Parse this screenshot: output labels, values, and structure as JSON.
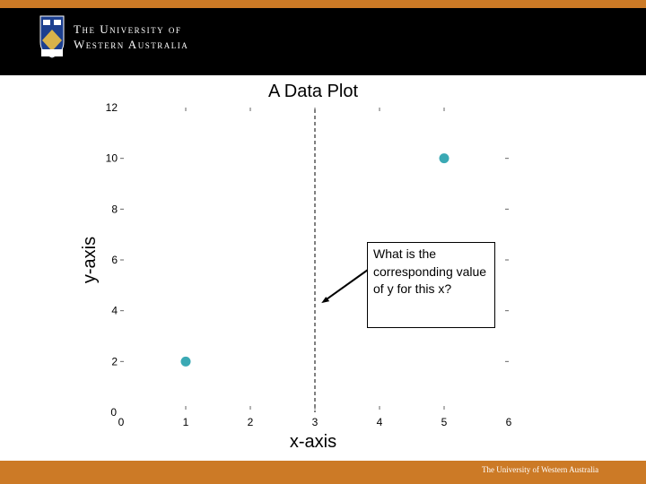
{
  "header": {
    "institution_line1": "The University of",
    "institution_line2": "Western Australia"
  },
  "footer": {
    "text": "The University of Western Australia"
  },
  "colors": {
    "accent": "#cc7a26",
    "header_bg": "#000000",
    "point": "#3aa9b4"
  },
  "chart_data": {
    "type": "scatter",
    "title": "A Data Plot",
    "xlabel": "x-axis",
    "ylabel": "y-axis",
    "xlim": [
      0,
      6
    ],
    "ylim": [
      0,
      12
    ],
    "xticks": [
      "0",
      "1",
      "2",
      "3",
      "4",
      "5",
      "6"
    ],
    "yticks": [
      "0",
      "2",
      "4",
      "6",
      "8",
      "10",
      "12"
    ],
    "grid": false,
    "points": [
      {
        "x": 1,
        "y": 2
      },
      {
        "x": 5,
        "y": 10
      }
    ],
    "reference_line": {
      "orientation": "vertical",
      "x": 3,
      "style": "dashed"
    },
    "annotation": {
      "text": "What is the corresponding value of y for this x?",
      "arrow_to": {
        "x": 3.1,
        "y": 4.3
      }
    }
  }
}
